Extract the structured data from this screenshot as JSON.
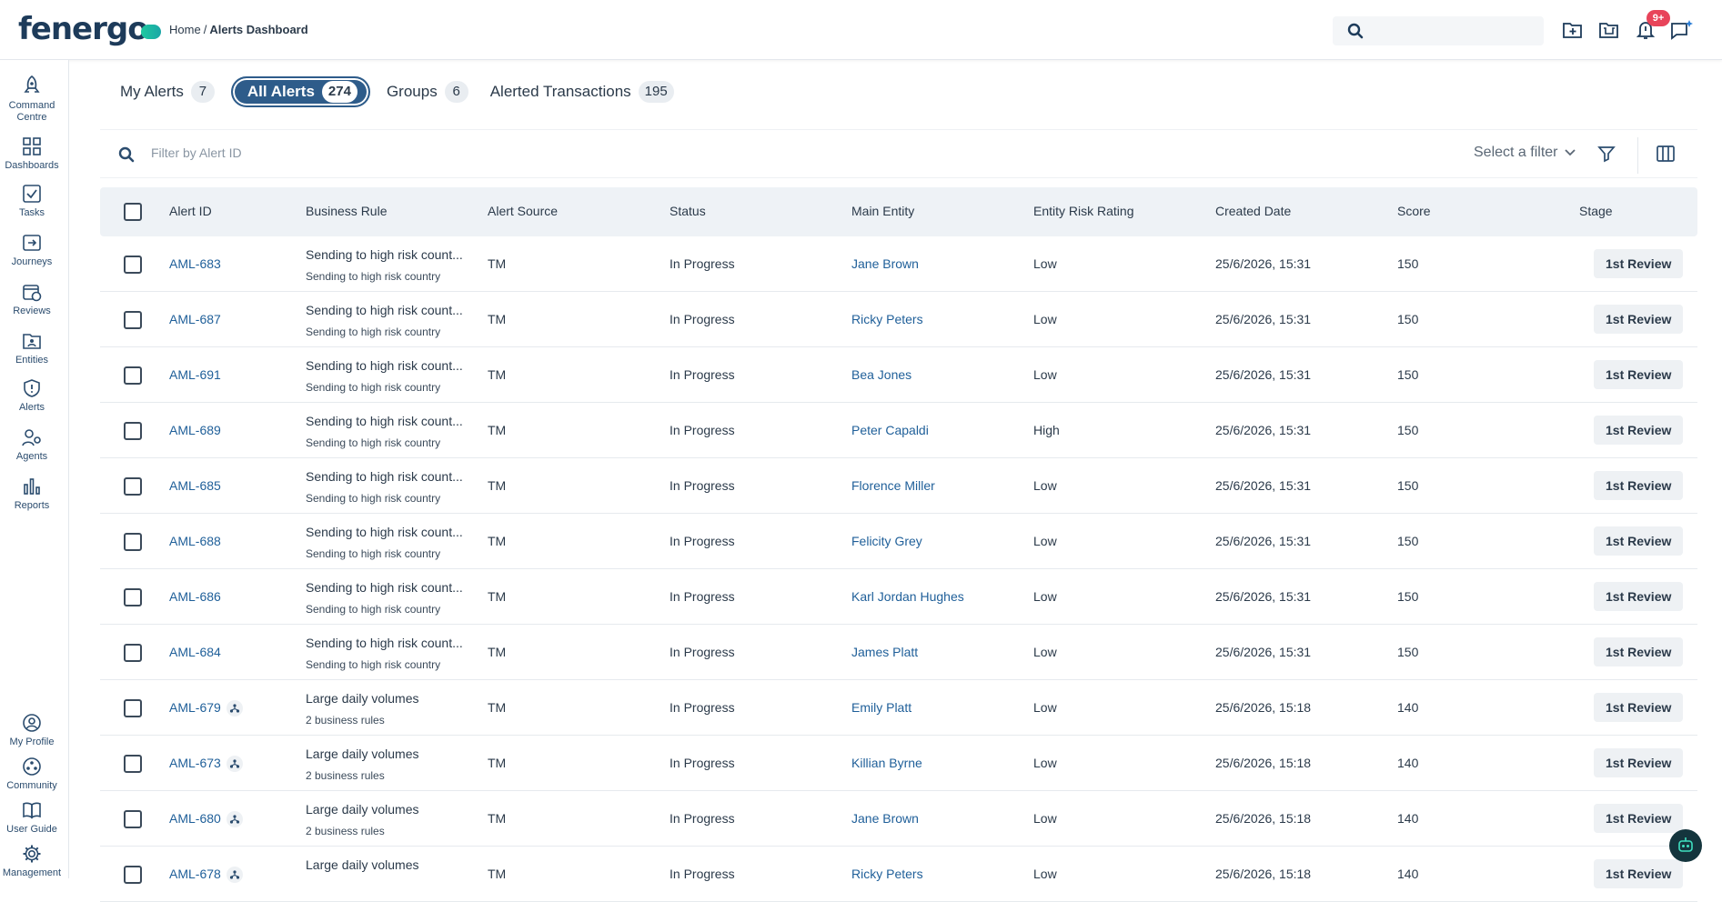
{
  "header": {
    "logo_text": "fenergo",
    "breadcrumb_home": "Home",
    "breadcrumb_sep": "/",
    "breadcrumb_current": "Alerts Dashboard",
    "notification_badge": "9+"
  },
  "sidebar": {
    "items": [
      {
        "label_line1": "Command",
        "label_line2": "Centre",
        "icon": "rocket-icon"
      },
      {
        "label_line1": "Dashboards",
        "label_line2": "",
        "icon": "dashboard-icon"
      },
      {
        "label_line1": "Tasks",
        "label_line2": "",
        "icon": "task-check-icon"
      },
      {
        "label_line1": "Journeys",
        "label_line2": "",
        "icon": "journey-icon"
      },
      {
        "label_line1": "Reviews",
        "label_line2": "",
        "icon": "calendar-clock-icon"
      },
      {
        "label_line1": "Entities",
        "label_line2": "",
        "icon": "folder-user-icon"
      },
      {
        "label_line1": "Alerts",
        "label_line2": "",
        "icon": "shield-alert-icon"
      },
      {
        "label_line1": "Agents",
        "label_line2": "",
        "icon": "user-gear-icon"
      },
      {
        "label_line1": "Reports",
        "label_line2": "",
        "icon": "bar-chart-icon"
      }
    ],
    "bottom_items": [
      {
        "label": "My Profile",
        "icon": "user-circle-icon"
      },
      {
        "label": "Community",
        "icon": "community-icon"
      },
      {
        "label": "User Guide",
        "icon": "book-icon"
      },
      {
        "label": "Management",
        "icon": "gear-icon"
      }
    ]
  },
  "tabs": [
    {
      "label": "My Alerts",
      "count": "7",
      "active": false
    },
    {
      "label": "All Alerts",
      "count": "274",
      "active": true
    },
    {
      "label": "Groups",
      "count": "6",
      "active": false
    },
    {
      "label": "Alerted Transactions",
      "count": "195",
      "active": false
    }
  ],
  "filter": {
    "placeholder": "Filter by Alert ID",
    "select_label": "Select a filter"
  },
  "table": {
    "columns": [
      "Alert ID",
      "Business Rule",
      "Alert Source",
      "Status",
      "Main Entity",
      "Entity Risk Rating",
      "Created Date",
      "Score",
      "Stage"
    ],
    "rows": [
      {
        "id": "AML-683",
        "rule": "Sending to high risk count...",
        "rule_sub": "Sending to high risk country",
        "source": "TM",
        "status": "In Progress",
        "entity": "Jane Brown",
        "risk": "Low",
        "created": "25/6/2026, 15:31",
        "score": "150",
        "stage": "1st Review",
        "group": false
      },
      {
        "id": "AML-687",
        "rule": "Sending to high risk count...",
        "rule_sub": "Sending to high risk country",
        "source": "TM",
        "status": "In Progress",
        "entity": "Ricky Peters",
        "risk": "Low",
        "created": "25/6/2026, 15:31",
        "score": "150",
        "stage": "1st Review",
        "group": false
      },
      {
        "id": "AML-691",
        "rule": "Sending to high risk count...",
        "rule_sub": "Sending to high risk country",
        "source": "TM",
        "status": "In Progress",
        "entity": "Bea Jones",
        "risk": "Low",
        "created": "25/6/2026, 15:31",
        "score": "150",
        "stage": "1st Review",
        "group": false
      },
      {
        "id": "AML-689",
        "rule": "Sending to high risk count...",
        "rule_sub": "Sending to high risk country",
        "source": "TM",
        "status": "In Progress",
        "entity": "Peter Capaldi",
        "risk": "High",
        "created": "25/6/2026, 15:31",
        "score": "150",
        "stage": "1st Review",
        "group": false
      },
      {
        "id": "AML-685",
        "rule": "Sending to high risk count...",
        "rule_sub": "Sending to high risk country",
        "source": "TM",
        "status": "In Progress",
        "entity": "Florence Miller",
        "risk": "Low",
        "created": "25/6/2026, 15:31",
        "score": "150",
        "stage": "1st Review",
        "group": false
      },
      {
        "id": "AML-688",
        "rule": "Sending to high risk count...",
        "rule_sub": "Sending to high risk country",
        "source": "TM",
        "status": "In Progress",
        "entity": "Felicity Grey",
        "risk": "Low",
        "created": "25/6/2026, 15:31",
        "score": "150",
        "stage": "1st Review",
        "group": false
      },
      {
        "id": "AML-686",
        "rule": "Sending to high risk count...",
        "rule_sub": "Sending to high risk country",
        "source": "TM",
        "status": "In Progress",
        "entity": "Karl Jordan Hughes",
        "risk": "Low",
        "created": "25/6/2026, 15:31",
        "score": "150",
        "stage": "1st Review",
        "group": false
      },
      {
        "id": "AML-684",
        "rule": "Sending to high risk count...",
        "rule_sub": "Sending to high risk country",
        "source": "TM",
        "status": "In Progress",
        "entity": "James Platt",
        "risk": "Low",
        "created": "25/6/2026, 15:31",
        "score": "150",
        "stage": "1st Review",
        "group": false
      },
      {
        "id": "AML-679",
        "rule": "Large daily volumes",
        "rule_sub": "2 business rules",
        "source": "TM",
        "status": "In Progress",
        "entity": "Emily Platt",
        "risk": "Low",
        "created": "25/6/2026, 15:18",
        "score": "140",
        "stage": "1st Review",
        "group": true
      },
      {
        "id": "AML-673",
        "rule": "Large daily volumes",
        "rule_sub": "2 business rules",
        "source": "TM",
        "status": "In Progress",
        "entity": "Killian Byrne",
        "risk": "Low",
        "created": "25/6/2026, 15:18",
        "score": "140",
        "stage": "1st Review",
        "group": true
      },
      {
        "id": "AML-680",
        "rule": "Large daily volumes",
        "rule_sub": "2 business rules",
        "source": "TM",
        "status": "In Progress",
        "entity": "Jane Brown",
        "risk": "Low",
        "created": "25/6/2026, 15:18",
        "score": "140",
        "stage": "1st Review",
        "group": true
      },
      {
        "id": "AML-678",
        "rule": "Large daily volumes",
        "rule_sub": "",
        "source": "TM",
        "status": "In Progress",
        "entity": "Ricky Peters",
        "risk": "Low",
        "created": "25/6/2026, 15:18",
        "score": "140",
        "stage": "1st Review",
        "group": true
      }
    ]
  },
  "colors": {
    "brand_navy": "#1d3b5a",
    "active_tab": "#2e5c8a",
    "link": "#1f5f99",
    "badge_red": "#e8445a"
  }
}
